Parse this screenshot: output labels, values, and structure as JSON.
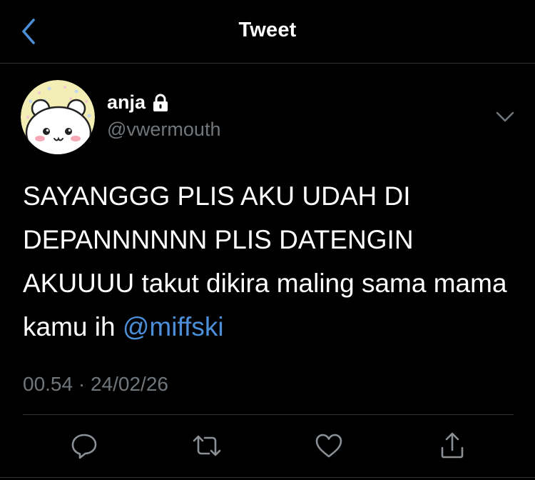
{
  "header": {
    "title": "Tweet",
    "back_icon": "chevron-left-icon"
  },
  "author": {
    "display_name": "anja",
    "handle": "@vwermouth",
    "protected_icon": "lock-icon",
    "avatar": "bear-avatar"
  },
  "tweet": {
    "text": "SAYANGGG PLIS AKU UDAH DI DEPANNNNNN PLIS DATENGIN AKUUUU takut dikira maling sama mama kamu ih",
    "mention": "@miffski",
    "time": "00.54",
    "separator": "·",
    "date": "24/02/26"
  },
  "actions": [
    {
      "name": "reply",
      "icon": "reply-icon"
    },
    {
      "name": "retweet",
      "icon": "retweet-icon"
    },
    {
      "name": "like",
      "icon": "heart-icon"
    },
    {
      "name": "share",
      "icon": "share-icon"
    }
  ],
  "colors": {
    "background": "#000000",
    "accent": "#4c8fd9",
    "muted": "#71767b",
    "divider": "#2f3336"
  }
}
